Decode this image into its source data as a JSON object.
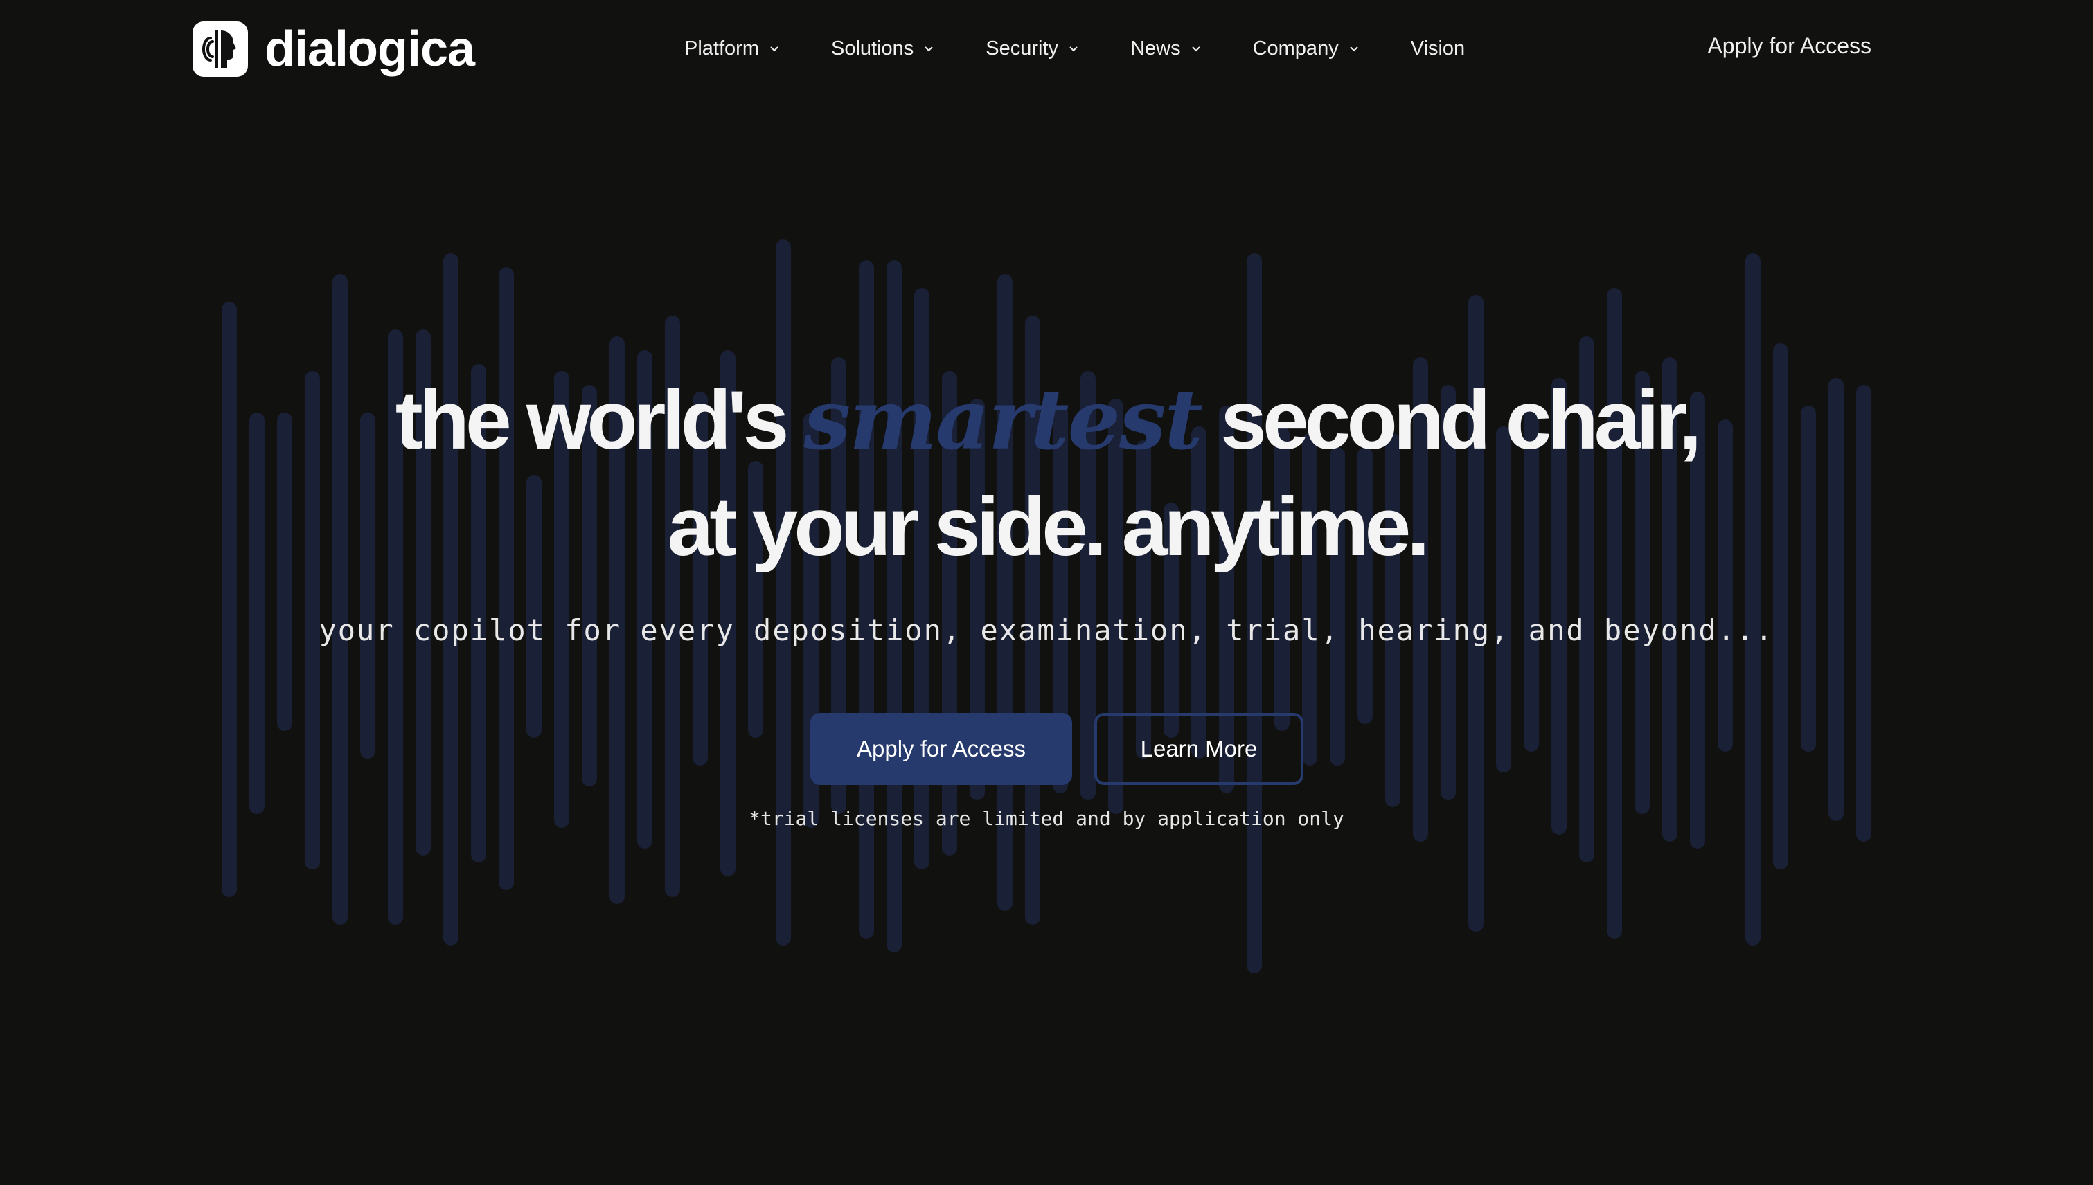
{
  "brand": {
    "name": "dialogica",
    "logo_icon": "face-profile-soundwave-icon"
  },
  "nav": {
    "items": [
      {
        "label": "Platform",
        "has_dropdown": true
      },
      {
        "label": "Solutions",
        "has_dropdown": true
      },
      {
        "label": "Security",
        "has_dropdown": true
      },
      {
        "label": "News",
        "has_dropdown": true
      },
      {
        "label": "Company",
        "has_dropdown": true
      },
      {
        "label": "Vision",
        "has_dropdown": false
      }
    ],
    "cta_label": "Apply for Access"
  },
  "hero": {
    "headline_part1": "the world's ",
    "headline_accent": "smartest",
    "headline_part2": " second chair,",
    "headline_line2": "at your side. anytime.",
    "subline": "your copilot for every deposition, examination, trial, hearing, and beyond...",
    "primary_button": "Apply for Access",
    "secondary_button": "Learn More",
    "disclaimer": "*trial licenses are limited and by application only"
  },
  "colors": {
    "background": "#111110",
    "accent": "#263a6e",
    "bar": "#1a2035",
    "text": "#f4f4f4"
  }
}
